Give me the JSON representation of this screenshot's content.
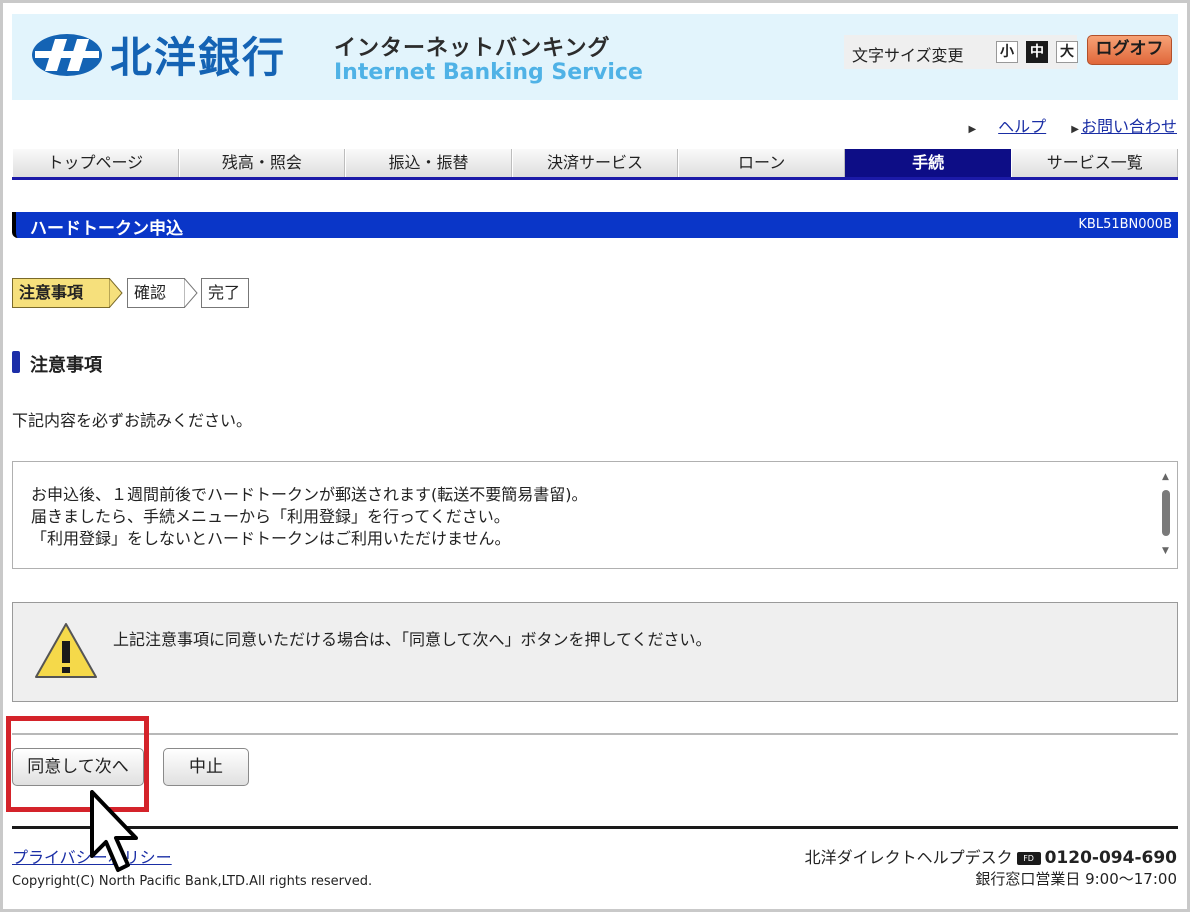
{
  "header": {
    "logo_text": "北洋銀行",
    "service_jp": "インターネットバンキング",
    "service_en": "Internet Banking Service",
    "font_size_label": "文字サイズ変更",
    "font_sizes": [
      "小",
      "中",
      "大"
    ],
    "font_size_selected": "中",
    "logoff_label": "ログオフ"
  },
  "top_links": {
    "help": "ヘルプ",
    "contact": "お問い合わせ"
  },
  "nav": {
    "items": [
      "トップページ",
      "残高・照会",
      "振込・振替",
      "決済サービス",
      "ローン",
      "手続",
      "サービス一覧"
    ],
    "active": "手続"
  },
  "page": {
    "title": "ハードトークン申込",
    "screen_code": "KBL51BN000B"
  },
  "steps": {
    "items": [
      "注意事項",
      "確認",
      "完了"
    ],
    "active": "注意事項"
  },
  "section": {
    "heading": "注意事項",
    "instruction": "下記内容を必ずお読みください。"
  },
  "notice": {
    "lines": [
      "お申込後、１週間前後でハードトークンが郵送されます(転送不要簡易書留)。",
      "届きましたら、手続メニューから「利用登録」を行ってください。",
      "「利用登録」をしないとハードトークンはご利用いただけません。"
    ]
  },
  "warning": {
    "text": "上記注意事項に同意いただける場合は、「同意して次へ」ボタンを押してください。"
  },
  "buttons": {
    "agree_next": "同意して次へ",
    "cancel": "中止"
  },
  "footer": {
    "privacy_policy": "プライバシーポリシー",
    "copyright": "Copyright(C) North Pacific Bank,LTD.All rights reserved.",
    "helpdesk_label": "北洋ダイレクトヘルプデスク",
    "phone": "0120-094-690",
    "hours": "銀行窓口営業日 9:00～17:00"
  },
  "colors": {
    "brand_blue": "#1463b4",
    "nav_active": "#0d0d86",
    "title_bar": "#0a36c8",
    "step_active": "#f6e07c",
    "highlight": "#d4232a",
    "logoff": "#e0673a"
  }
}
